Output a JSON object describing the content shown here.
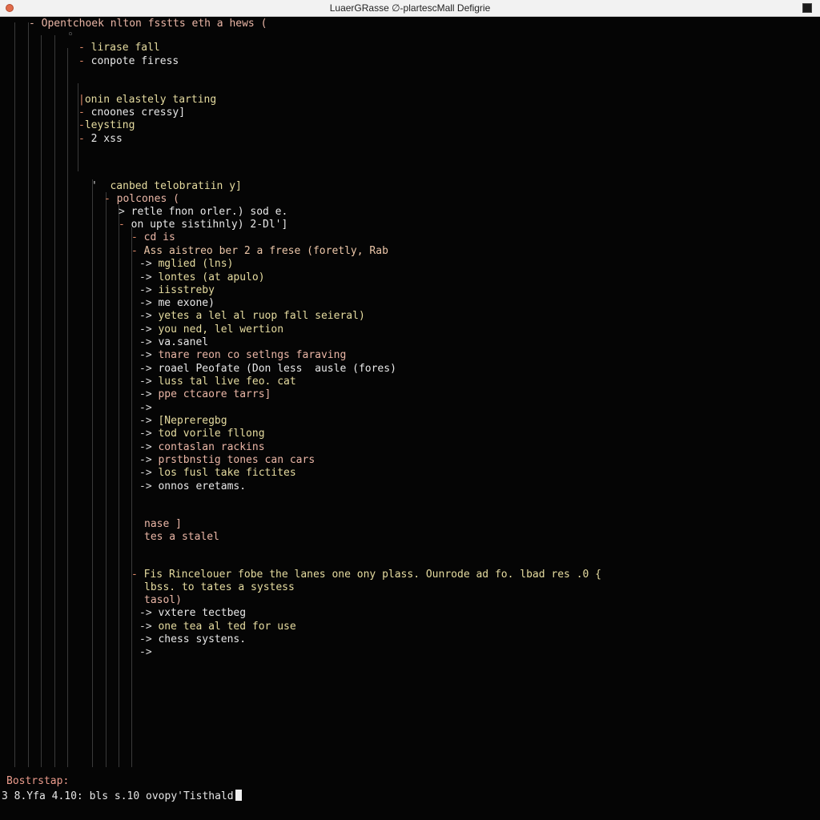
{
  "window": {
    "title": "LuaerGRasse ∅-plartescMall Defigrie"
  },
  "header": {
    "line": "- Opentchoek nlton fsstts eth a hews ("
  },
  "tree": [
    {
      "marker": "-",
      "text": "lirase fall"
    },
    {
      "marker": "-",
      "text": "conpote firess"
    },
    {
      "marker": "|",
      "text": "onin elastely tarting"
    },
    {
      "marker": "-",
      "text": "cnoones cressy]"
    },
    {
      "marker": "-",
      "text": "leysting"
    },
    {
      "marker": "-",
      "text": "2 xss"
    },
    {
      "marker": "'",
      "text": "canbed telobratiin y]"
    },
    {
      "marker": "-",
      "text": "polcones ("
    },
    {
      "marker": ">",
      "text": "retle fnon orler.) sod e."
    },
    {
      "marker": "-",
      "text": "on upte sistihnly) 2-Dl']"
    },
    {
      "marker": "-",
      "text": "cd is"
    },
    {
      "marker": "-",
      "text": "Ass aistreo ber 2 a frese (foretly, Rab"
    },
    {
      "marker": "->",
      "text": "mglied (lns)"
    },
    {
      "marker": "->",
      "text": "lontes (at apulo)"
    },
    {
      "marker": "->",
      "text": "iisstreby"
    },
    {
      "marker": "->",
      "text": "me exone)"
    },
    {
      "marker": "->",
      "text": "yetes a lel al ruop fall seieral)"
    },
    {
      "marker": "->",
      "text": "you ned, lel wertion"
    },
    {
      "marker": "->",
      "text": "va.sanel"
    },
    {
      "marker": "->",
      "text": "tnare reon co setlngs faraving"
    },
    {
      "marker": "->",
      "text": "roael Peofate (Don less  ausle (fores)"
    },
    {
      "marker": "->",
      "text": "luss tal live feo. cat"
    },
    {
      "marker": "->",
      "text": "ppe ctcaore tarrs]"
    },
    {
      "marker": "->",
      "text": ""
    },
    {
      "marker": "->",
      "text": "[Nepreregbg"
    },
    {
      "marker": "->",
      "text": "tod vorile fllong"
    },
    {
      "marker": "->",
      "text": "contaslan rackins"
    },
    {
      "marker": "->",
      "text": "prstbnstig tones can cars"
    },
    {
      "marker": "->",
      "text": "los fusl take fictites"
    },
    {
      "marker": "->",
      "text": "onnos eretams."
    },
    {
      "marker": "",
      "text": "nase ]"
    },
    {
      "marker": "",
      "text": "tes a stalel"
    },
    {
      "marker": "-",
      "text": "Fis Rincelouer fobe the lanes one ony plass. Ounrode ad fo. lbad res .0 {"
    },
    {
      "marker": "",
      "text": "lbss. to tates a systess"
    },
    {
      "marker": "",
      "text": "tasol)"
    },
    {
      "marker": "->",
      "text": "vxtere tectbeg"
    },
    {
      "marker": "->",
      "text": "one tea al ted for use"
    },
    {
      "marker": "->",
      "text": "chess systens."
    },
    {
      "marker": "->",
      "text": ""
    }
  ],
  "status": {
    "label": "Bostrstap:",
    "value": "3 8.Yfa 4.10: bls s.10 ovopy'Tisthald"
  },
  "colors": {
    "background": "#050505",
    "marker": "#e08a6a",
    "text_yellow": "#e6dca0",
    "text_pink": "#eab6a6"
  }
}
